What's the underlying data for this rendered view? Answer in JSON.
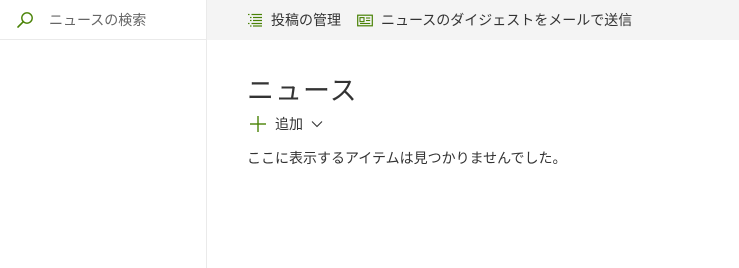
{
  "search": {
    "placeholder": "ニュースの検索",
    "icon": "search-icon"
  },
  "command_bar": {
    "items": [
      {
        "label": "投稿の管理",
        "icon": "list-icon"
      },
      {
        "label": "ニュースのダイジェストをメールで送信",
        "icon": "newspaper-icon"
      }
    ]
  },
  "main": {
    "title": "ニュース",
    "add": {
      "label": "追加",
      "icon": "plus-icon",
      "dropdown_icon": "chevron-down-icon"
    },
    "empty_message": "ここに表示するアイテムは見つかりませんでした。"
  },
  "colors": {
    "accent": "#498205",
    "command_bar_bg": "#f4f4f4",
    "text": "#333333",
    "placeholder": "#666666",
    "divider": "#eaeaea"
  }
}
